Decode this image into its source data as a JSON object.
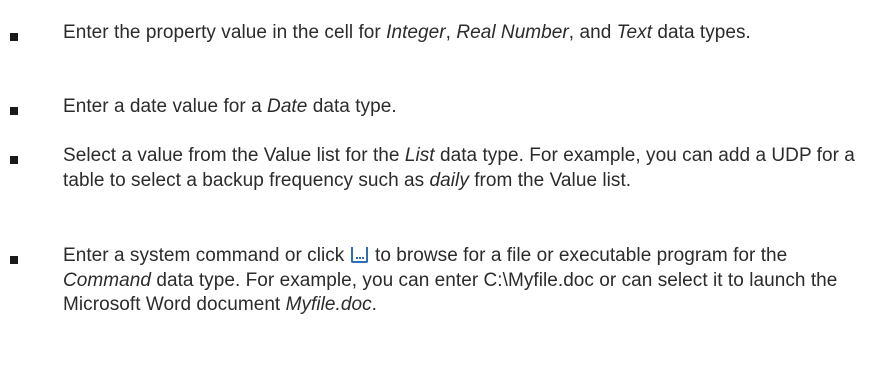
{
  "bullets": [
    {
      "segments": [
        {
          "text": "Enter the property value in the cell for ",
          "style": "normal"
        },
        {
          "text": "Integer",
          "style": "italic"
        },
        {
          "text": ", ",
          "style": "normal"
        },
        {
          "text": "Real Number",
          "style": "italic"
        },
        {
          "text": ", and ",
          "style": "normal"
        },
        {
          "text": "Text",
          "style": "italic"
        },
        {
          "text": " data types.",
          "style": "normal"
        }
      ]
    },
    {
      "segments": [
        {
          "text": "Enter a date value for a ",
          "style": "normal"
        },
        {
          "text": "Date",
          "style": "italic"
        },
        {
          "text": " data type.",
          "style": "normal"
        }
      ]
    },
    {
      "segments": [
        {
          "text": "Select a value from the Value list for the ",
          "style": "normal"
        },
        {
          "text": "List",
          "style": "italic"
        },
        {
          "text": " data type. For example, you can add a UDP for a table to select a backup frequency such as ",
          "style": "normal"
        },
        {
          "text": "daily",
          "style": "italic"
        },
        {
          "text": " from the Value list.",
          "style": "normal"
        }
      ]
    },
    {
      "segments": [
        {
          "text": "Enter a system command or click ",
          "style": "normal"
        },
        {
          "icon": "browse-icon"
        },
        {
          "text": " to browse for a file or executable program for the ",
          "style": "normal"
        },
        {
          "text": "Command",
          "style": "italic"
        },
        {
          "text": " data type. For example, you can enter C:\\Myfile.doc or can select it to launch the Microsoft Word document ",
          "style": "normal"
        },
        {
          "text": "Myfile.doc",
          "style": "italic"
        },
        {
          "text": ".",
          "style": "normal"
        }
      ]
    }
  ]
}
